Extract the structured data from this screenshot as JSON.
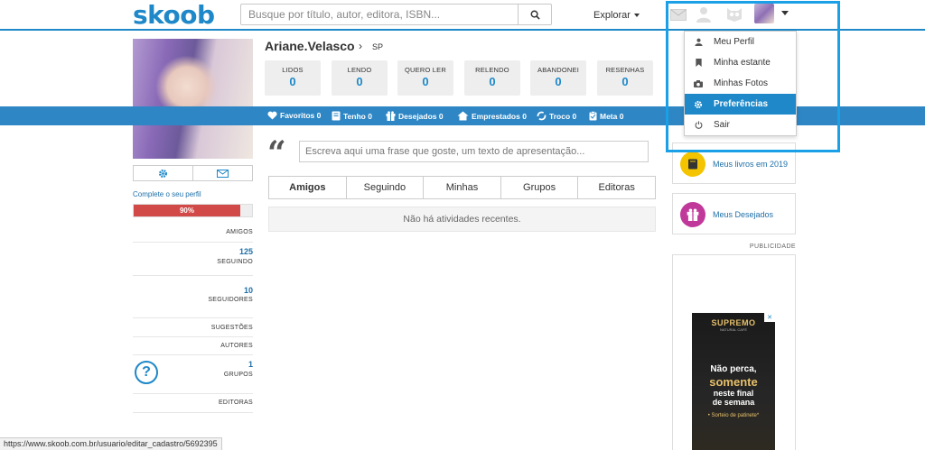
{
  "header": {
    "logo": "skoob",
    "search_placeholder": "Busque por título, autor, editora, ISBN...",
    "explorar": "Explorar"
  },
  "menu": {
    "items": [
      {
        "label": "Meu Perfil",
        "icon": "user-icon"
      },
      {
        "label": "Minha estante",
        "icon": "bookmark-icon"
      },
      {
        "label": "Minhas Fotos",
        "icon": "camera-icon"
      },
      {
        "label": "Preferências",
        "icon": "gear-icon",
        "active": true
      },
      {
        "label": "Sair",
        "icon": "power-icon"
      }
    ]
  },
  "profile": {
    "name": "Ariane.Velasco",
    "state": "SP",
    "complete_link": "Complete o seu perfil",
    "progress_label": "90%",
    "progress_value": 0.9
  },
  "stats": [
    {
      "label": "LIDOS",
      "value": "0"
    },
    {
      "label": "LENDO",
      "value": "0"
    },
    {
      "label": "QUERO LER",
      "value": "0"
    },
    {
      "label": "RELENDO",
      "value": "0"
    },
    {
      "label": "ABANDONEI",
      "value": "0"
    },
    {
      "label": "RESENHAS",
      "value": "0"
    }
  ],
  "bluebar": [
    {
      "label": "Favoritos 0",
      "icon": "heart-icon"
    },
    {
      "label": "Tenho 0",
      "icon": "book-icon"
    },
    {
      "label": "Desejados 0",
      "icon": "gift-icon"
    },
    {
      "label": "Emprestados 0",
      "icon": "house-icon"
    },
    {
      "label": "Troco 0",
      "icon": "swap-icon"
    },
    {
      "label": "Meta 0",
      "icon": "clipboard-icon"
    }
  ],
  "phrase_placeholder": "Escreva aqui uma frase que goste, um texto de apresentação...",
  "tabs": [
    "Amigos",
    "Seguindo",
    "Minhas",
    "Grupos",
    "Editoras"
  ],
  "no_activity": "Não há atividades recentes.",
  "sidebar": {
    "amigos": "AMIGOS",
    "seguindo_count": "125",
    "seguindo": "SEGUINDO",
    "seguidores_count": "10",
    "seguidores": "SEGUIDORES",
    "sugestoes": "SUGESTÕES",
    "autores": "AUTORES",
    "grupos_count": "1",
    "grupos": "GRUPOS",
    "editoras": "EDITORAS"
  },
  "right": {
    "livros": "Meus livros em 2019",
    "desejados": "Meus Desejados",
    "publicidade": "PUBLICIDADE"
  },
  "ad": {
    "brand": "SUPREMO",
    "brand_sub": "NATURAL CAFÉ",
    "line1": "Não perca,",
    "line2": "somente",
    "line3a": "neste final",
    "line3b": "de semana",
    "line4": "• Sorteio de patinete*"
  },
  "status_url": "https://www.skoob.com.br/usuario/editar_cadastro/5692395",
  "colors": {
    "brand_blue": "#1e88c8",
    "bar_blue": "#2e86c4",
    "progress_red": "#d24a48",
    "highlight": "#1aa0e6"
  }
}
